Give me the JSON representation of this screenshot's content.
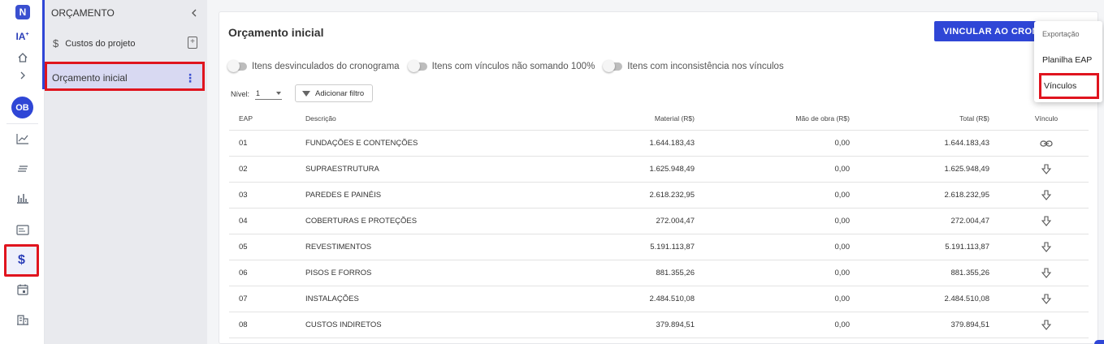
{
  "rail": {
    "logo": "N",
    "ia_label": "IA",
    "avatar_initials": "OB",
    "icons": [
      "home-icon",
      "chevron-right-icon",
      "line-chart-icon",
      "list-icon",
      "bar-chart-icon",
      "card-icon",
      "dollar-icon",
      "calendar-icon",
      "building-icon"
    ]
  },
  "sidebar": {
    "title": "ORÇAMENTO",
    "link_label": "Custos do projeto",
    "active_label": "Orçamento inicial"
  },
  "main": {
    "title": "Orçamento inicial",
    "vincular_button": "VINCULAR AO CRONOGRAMA",
    "toggles": [
      {
        "label": "Itens desvinculados do cronograma"
      },
      {
        "label": "Itens com vínculos não somando 100%"
      },
      {
        "label": "Itens com inconsistência nos vínculos"
      }
    ],
    "nivel_label": "Nível:",
    "nivel_value": "1",
    "filter_label": "Adicionar filtro"
  },
  "table": {
    "headers": {
      "eap": "EAP",
      "desc": "Descrição",
      "material": "Material (R$)",
      "mao": "Mão de obra (R$)",
      "total": "Total (R$)",
      "vinculo": "Vínculo"
    },
    "rows": [
      {
        "eap": "01",
        "desc": "FUNDAÇÕES E CONTENÇÕES",
        "material": "1.644.183,43",
        "mao": "0,00",
        "total": "1.644.183,43",
        "vinculo": "link"
      },
      {
        "eap": "02",
        "desc": "SUPRAESTRUTURA",
        "material": "1.625.948,49",
        "mao": "0,00",
        "total": "1.625.948,49",
        "vinculo": "arrow"
      },
      {
        "eap": "03",
        "desc": "PAREDES E PAINÉIS",
        "material": "2.618.232,95",
        "mao": "0,00",
        "total": "2.618.232,95",
        "vinculo": "arrow"
      },
      {
        "eap": "04",
        "desc": "COBERTURAS E PROTEÇÕES",
        "material": "272.004,47",
        "mao": "0,00",
        "total": "272.004,47",
        "vinculo": "arrow"
      },
      {
        "eap": "05",
        "desc": "REVESTIMENTOS",
        "material": "5.191.113,87",
        "mao": "0,00",
        "total": "5.191.113,87",
        "vinculo": "arrow"
      },
      {
        "eap": "06",
        "desc": "PISOS E FORROS",
        "material": "881.355,26",
        "mao": "0,00",
        "total": "881.355,26",
        "vinculo": "arrow"
      },
      {
        "eap": "07",
        "desc": "INSTALAÇÕES",
        "material": "2.484.510,08",
        "mao": "0,00",
        "total": "2.484.510,08",
        "vinculo": "arrow"
      },
      {
        "eap": "08",
        "desc": "CUSTOS INDIRETOS",
        "material": "379.894,51",
        "mao": "0,00",
        "total": "379.894,51",
        "vinculo": "arrow"
      }
    ]
  },
  "menu": {
    "heading": "Exportação",
    "items": [
      "Planilha EAP",
      "Vínculos"
    ]
  },
  "colors": {
    "accent": "#2f46d6",
    "highlight": "#e0141e",
    "active_bg": "#d8d9f2"
  }
}
